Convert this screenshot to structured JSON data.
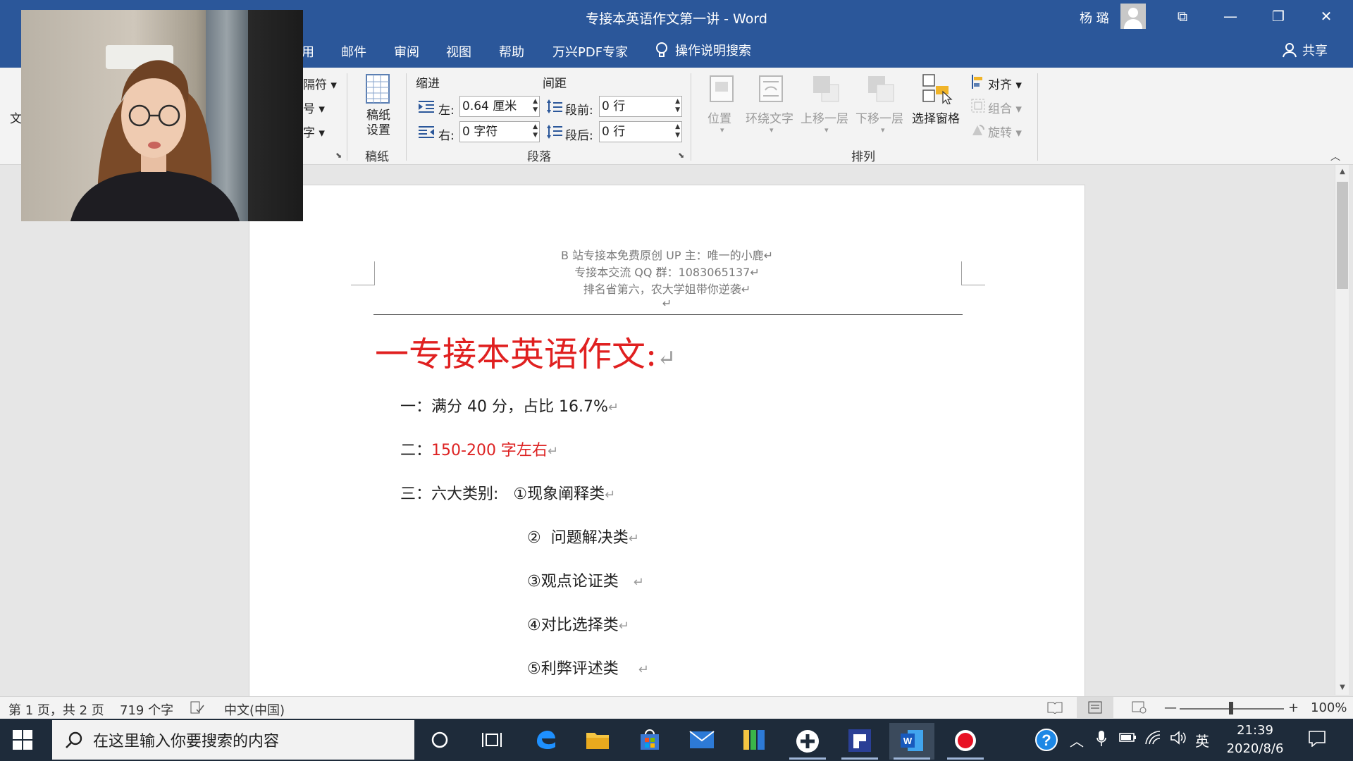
{
  "window": {
    "title": "专接本英语作文第一讲 - Word",
    "user": "杨 璐",
    "minimize_glyph": "—",
    "restore_glyph": "❐",
    "close_glyph": "✕",
    "ribbon_display_glyph": "⧉"
  },
  "tabs": [
    {
      "label": "用"
    },
    {
      "label": "邮件"
    },
    {
      "label": "审阅"
    },
    {
      "label": "视图"
    },
    {
      "label": "帮助"
    },
    {
      "label": "万兴PDF专家"
    }
  ],
  "tell_me": "操作说明搜索",
  "share": "共享",
  "ribbon": {
    "partial_left": {
      "item1": "隔符 ▾",
      "item2": "号 ▾",
      "item3": "字 ▾",
      "edge_text": "文"
    },
    "manuscript": {
      "button": "稿纸\n设置",
      "group_label": "稿纸"
    },
    "paragraph": {
      "indent_header": "缩进",
      "spacing_header": "间距",
      "left_label": "左:",
      "left_value": "0.64 厘米",
      "right_label": "右:",
      "right_value": "0 字符",
      "before_label": "段前:",
      "before_value": "0 行",
      "after_label": "段后:",
      "after_value": "0 行",
      "group_label": "段落"
    },
    "arrange": {
      "position": "位置",
      "wrap_text": "环绕文字",
      "bring_forward": "上移一层",
      "send_backward": "下移一层",
      "selection_pane": "选择窗格",
      "align": "对齐 ▾",
      "group": "组合 ▾",
      "rotate": "旋转 ▾",
      "group_label": "排列"
    }
  },
  "document": {
    "header_lines": [
      "B 站专接本免费原创 UP 主：唯一的小鹿↵",
      "专接本交流 QQ 群：1083065137↵",
      "排名省第六，农大学姐带你逆袭↵",
      "↵"
    ],
    "heading": "一专接本英语作文:",
    "para_mark": "↵",
    "lines": [
      {
        "prefix": "一：",
        "text": "满分 40 分，占比 16.7%"
      },
      {
        "prefix": "二：",
        "text": "150-200 字左右"
      },
      {
        "prefix": "三：",
        "text": "六大类别:   ①现象阐释类"
      },
      {
        "prefix": "",
        "text": "②  问题解决类"
      },
      {
        "prefix": "",
        "text": "③观点论证类   "
      },
      {
        "prefix": "",
        "text": "④对比选择类"
      },
      {
        "prefix": "",
        "text": "⑤利弊评述类    "
      }
    ]
  },
  "status": {
    "page": "第 1 页，共 2 页",
    "words": "719 个字",
    "language": "中文(中国)",
    "zoom": "100%",
    "zoom_minus": "—",
    "zoom_plus": "+"
  },
  "taskbar": {
    "search_placeholder": "在这里输入你要搜索的内容",
    "ime": "英",
    "time": "21:39",
    "date": "2020/8/6"
  },
  "colors": {
    "title_bar": "#2b579a",
    "heading_red": "#e02020",
    "taskbar": "#1e2b3a"
  }
}
